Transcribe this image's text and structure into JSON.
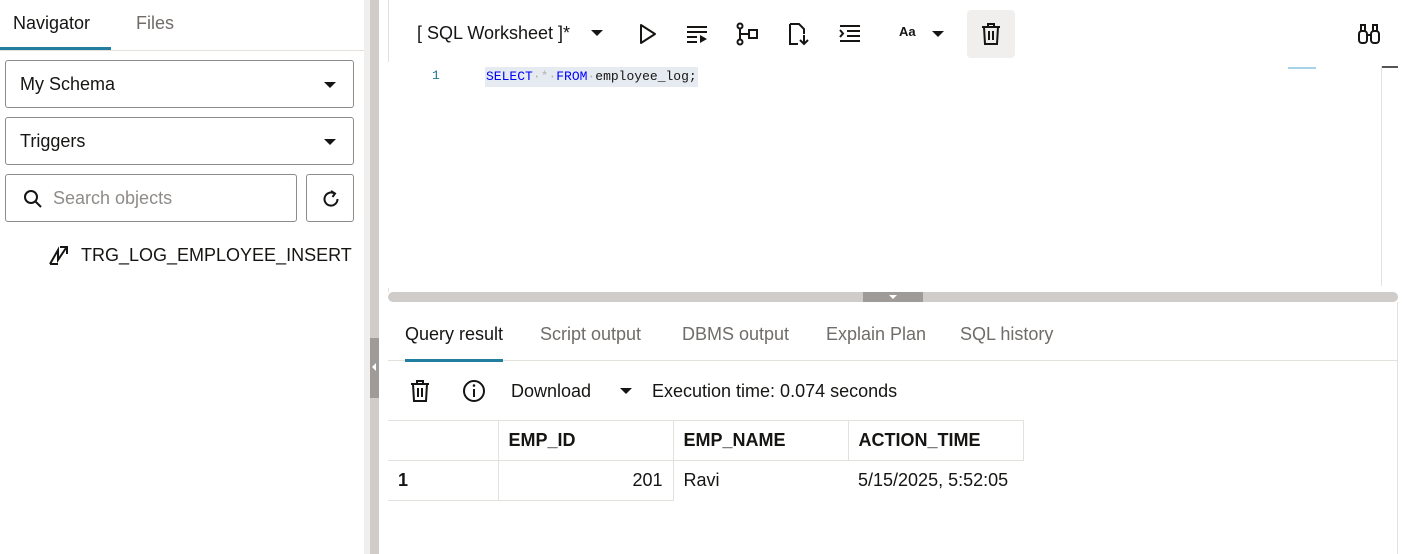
{
  "navigator": {
    "tabs": [
      {
        "label": "Navigator",
        "active": true
      },
      {
        "label": "Files",
        "active": false
      }
    ],
    "schema_select": "My Schema",
    "object_type_select": "Triggers",
    "search": {
      "placeholder": "Search objects",
      "value": ""
    },
    "tree_items": [
      {
        "label": "TRG_LOG_EMPLOYEE_INSERT",
        "icon": "trigger-icon"
      }
    ]
  },
  "worksheet": {
    "title": "[ SQL Worksheet ]*",
    "toolbar_icons": [
      "run-statement-icon",
      "run-script-icon",
      "explain-plan-icon",
      "autotrace-icon",
      "format-icon",
      "font-size-icon",
      "clear-icon",
      "find-icon"
    ],
    "font_button_label": "Aa",
    "editor": {
      "line_number": "1",
      "code": "SELECT * FROM employee_log;",
      "tokens": [
        {
          "text": "SELECT",
          "type": "kw"
        },
        {
          "text": "*",
          "type": "op"
        },
        {
          "text": "FROM",
          "type": "kw"
        },
        {
          "text": "employee_log;",
          "type": "ident"
        }
      ]
    }
  },
  "results": {
    "tabs": [
      {
        "label": "Query result",
        "active": true
      },
      {
        "label": "Script output",
        "active": false
      },
      {
        "label": "DBMS output",
        "active": false
      },
      {
        "label": "Explain Plan",
        "active": false
      },
      {
        "label": "SQL history",
        "active": false
      }
    ],
    "download_label": "Download",
    "execution_time": "Execution time: 0.074 seconds",
    "table": {
      "columns": [
        "EMP_ID",
        "EMP_NAME",
        "ACTION_TIME"
      ],
      "rows": [
        {
          "row_number": "1",
          "cells": [
            "201",
            "Ravi",
            "5/15/2025, 5:52:05"
          ]
        }
      ]
    }
  },
  "colors": {
    "accent": "#227e9e",
    "keyword": "#0000ff",
    "line_number": "#237893",
    "selection": "#e5ebf1"
  }
}
